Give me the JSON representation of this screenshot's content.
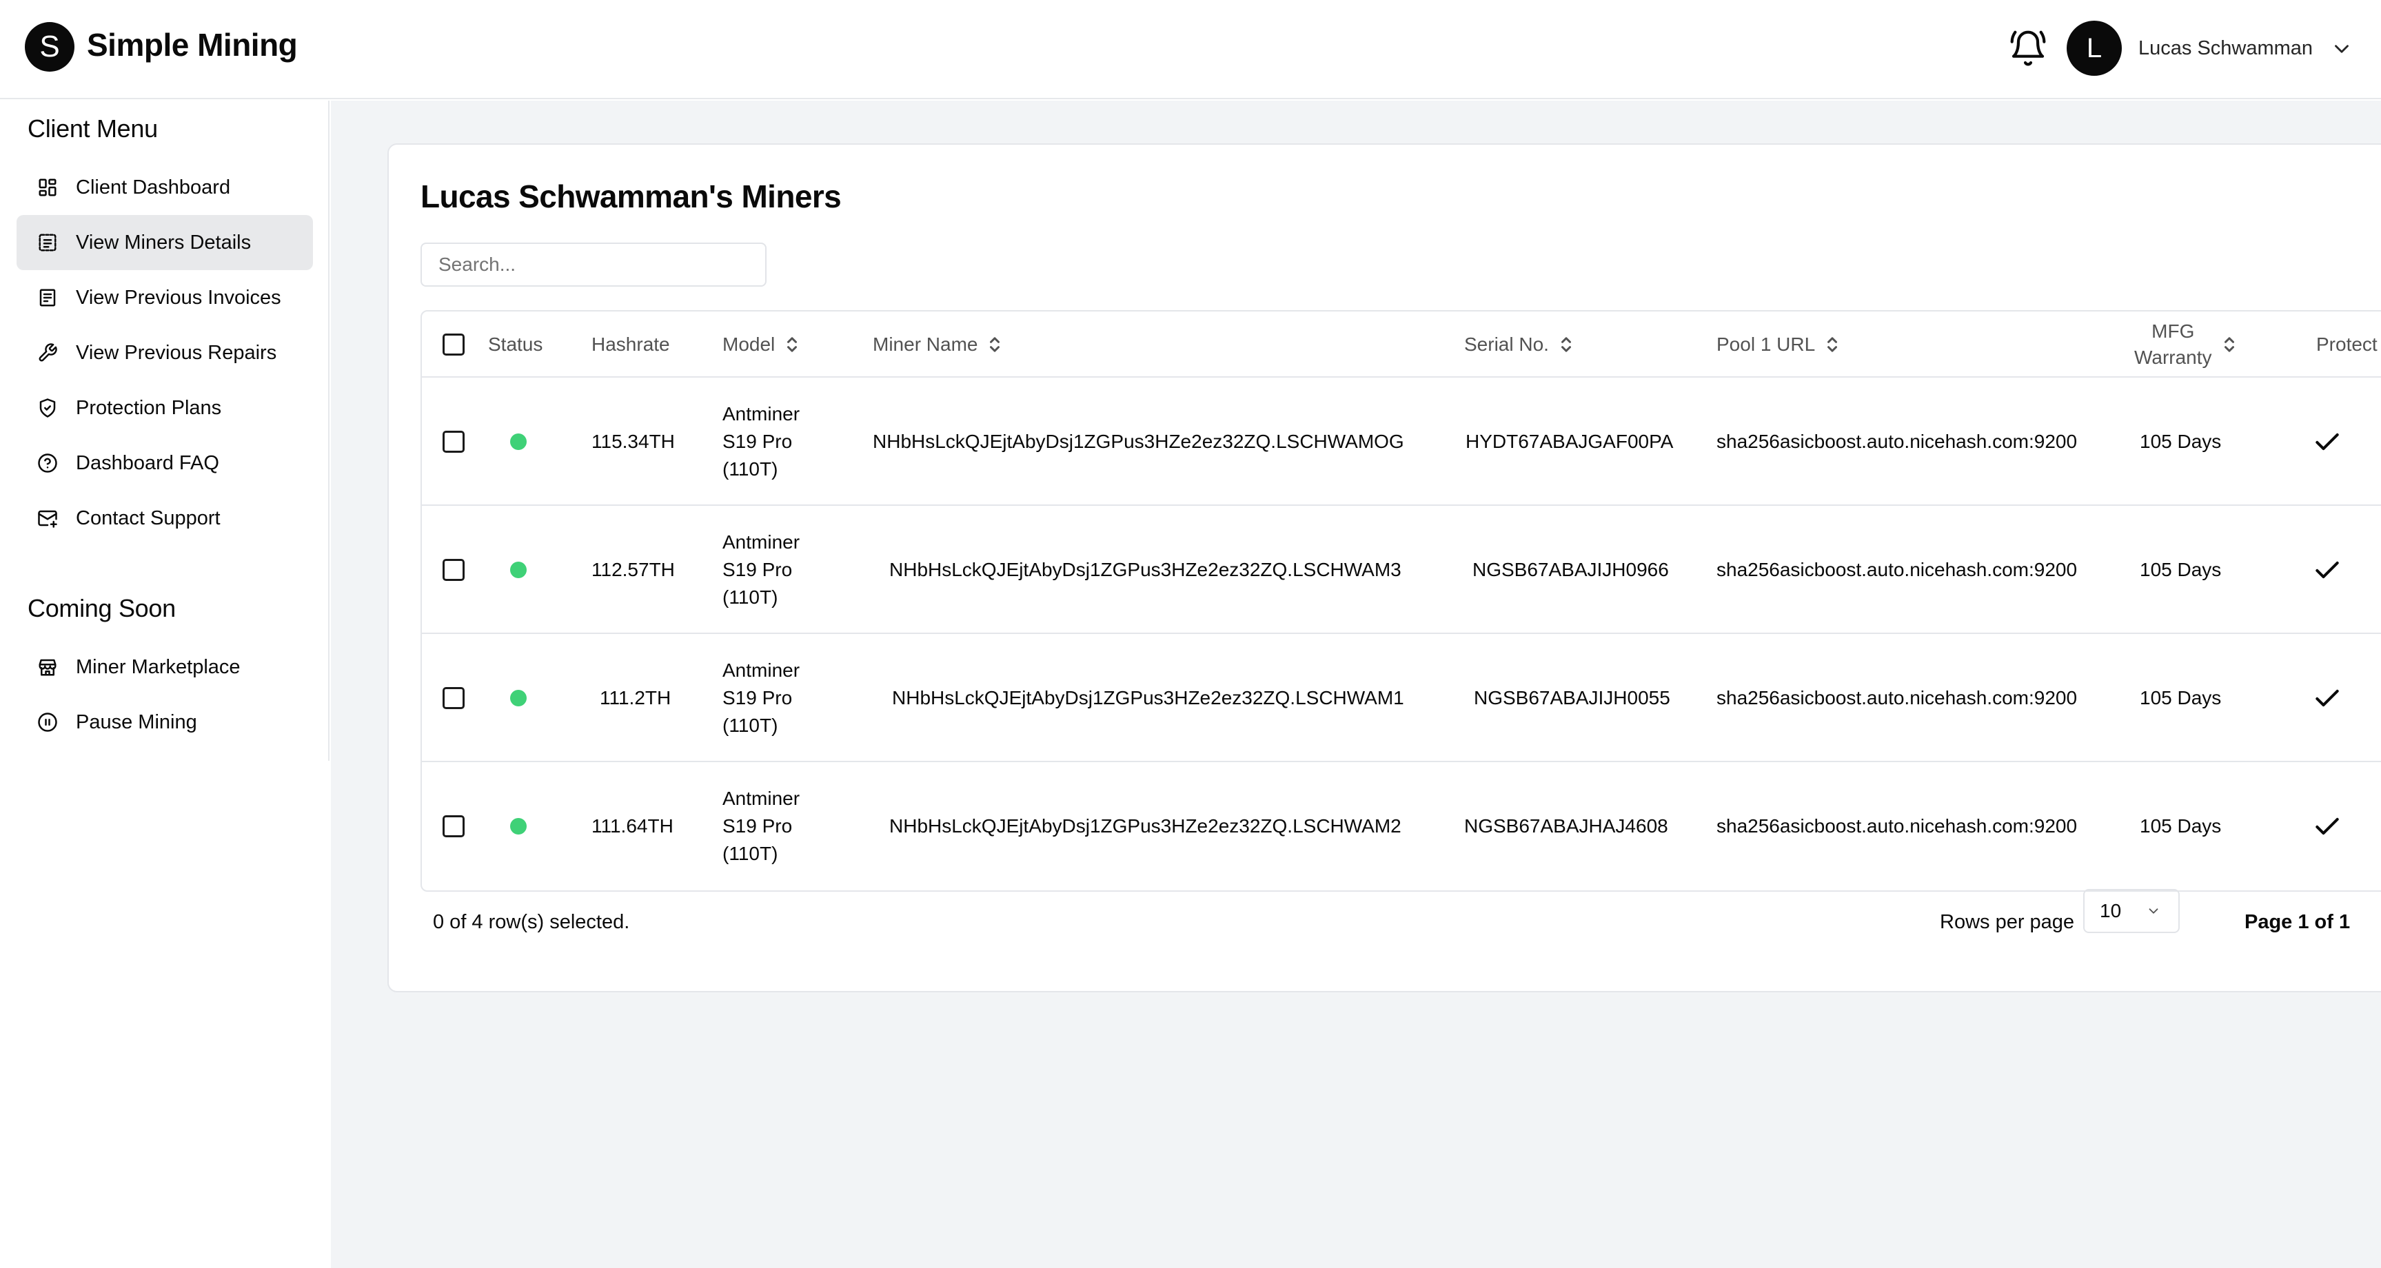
{
  "brand": {
    "name": "Simple Mining",
    "logo_letter": "S"
  },
  "header": {
    "user_initial": "L",
    "user_name": "Lucas Schwamman",
    "icons": {
      "bell": "bell-icon",
      "chevron": "chevron-down-icon"
    }
  },
  "sidebar": {
    "client_menu_title": "Client Menu",
    "client_items": [
      {
        "label": "Client Dashboard",
        "icon": "dashboard-grid-icon"
      },
      {
        "label": "View Miners Details",
        "icon": "list-details-icon",
        "active": true
      },
      {
        "label": "View Previous Invoices",
        "icon": "invoice-icon"
      },
      {
        "label": "View Previous Repairs",
        "icon": "wrench-icon"
      },
      {
        "label": "Protection Plans",
        "icon": "shield-check-icon"
      },
      {
        "label": "Dashboard FAQ",
        "icon": "help-circle-icon"
      },
      {
        "label": "Contact Support",
        "icon": "mail-icon"
      }
    ],
    "coming_soon_title": "Coming Soon",
    "coming_soon_items": [
      {
        "label": "Miner Marketplace",
        "icon": "store-icon"
      },
      {
        "label": "Pause Mining",
        "icon": "pause-circle-icon"
      }
    ]
  },
  "main": {
    "title": "Lucas Schwamman's Miners",
    "search_placeholder": "Search...",
    "table": {
      "columns": {
        "status": "Status",
        "hashrate": "Hashrate",
        "model": "Model",
        "miner_name": "Miner Name",
        "serial": "Serial No.",
        "pool": "Pool 1 URL",
        "warranty_line1": "MFG",
        "warranty_line2": "Warranty",
        "protection": "Protect"
      },
      "rows": [
        {
          "hashrate": "115.34TH",
          "model_line1": "Antminer",
          "model_line2": "S19 Pro",
          "model_line3": "(110T)",
          "miner_name": "NHbHsLckQJEjtAbyDsj1ZGPus3HZe2ez32ZQ.LSCHWAMOG",
          "serial": "HYDT67ABAJGAF00PA",
          "pool": "sha256asicboost.auto.nicehash.com:9200",
          "warranty": "105 Days",
          "status_color": "#3fd177"
        },
        {
          "hashrate": "112.57TH",
          "model_line1": "Antminer",
          "model_line2": "S19 Pro",
          "model_line3": "(110T)",
          "miner_name": "NHbHsLckQJEjtAbyDsj1ZGPus3HZe2ez32ZQ.LSCHWAM3",
          "serial": "NGSB67ABAJIJH0966",
          "pool": "sha256asicboost.auto.nicehash.com:9200",
          "warranty": "105 Days",
          "status_color": "#3fd177"
        },
        {
          "hashrate": "111.2TH",
          "model_line1": "Antminer",
          "model_line2": "S19 Pro",
          "model_line3": "(110T)",
          "miner_name": "NHbHsLckQJEjtAbyDsj1ZGPus3HZe2ez32ZQ.LSCHWAM1",
          "serial": "NGSB67ABAJIJH0055",
          "pool": "sha256asicboost.auto.nicehash.com:9200",
          "warranty": "105 Days",
          "status_color": "#3fd177"
        },
        {
          "hashrate": "111.64TH",
          "model_line1": "Antminer",
          "model_line2": "S19 Pro",
          "model_line3": "(110T)",
          "miner_name": "NHbHsLckQJEjtAbyDsj1ZGPus3HZe2ez32ZQ.LSCHWAM2",
          "serial": "NGSB67ABAJHAJ4608",
          "pool": "sha256asicboost.auto.nicehash.com:9200",
          "warranty": "105 Days",
          "status_color": "#3fd177"
        }
      ]
    },
    "footer": {
      "selection": "0 of 4 row(s) selected.",
      "rows_per_page_label": "Rows per page",
      "rows_per_page_value": "10",
      "page_indicator": "Page 1 of 1",
      "first_page_glyph": "«"
    }
  }
}
